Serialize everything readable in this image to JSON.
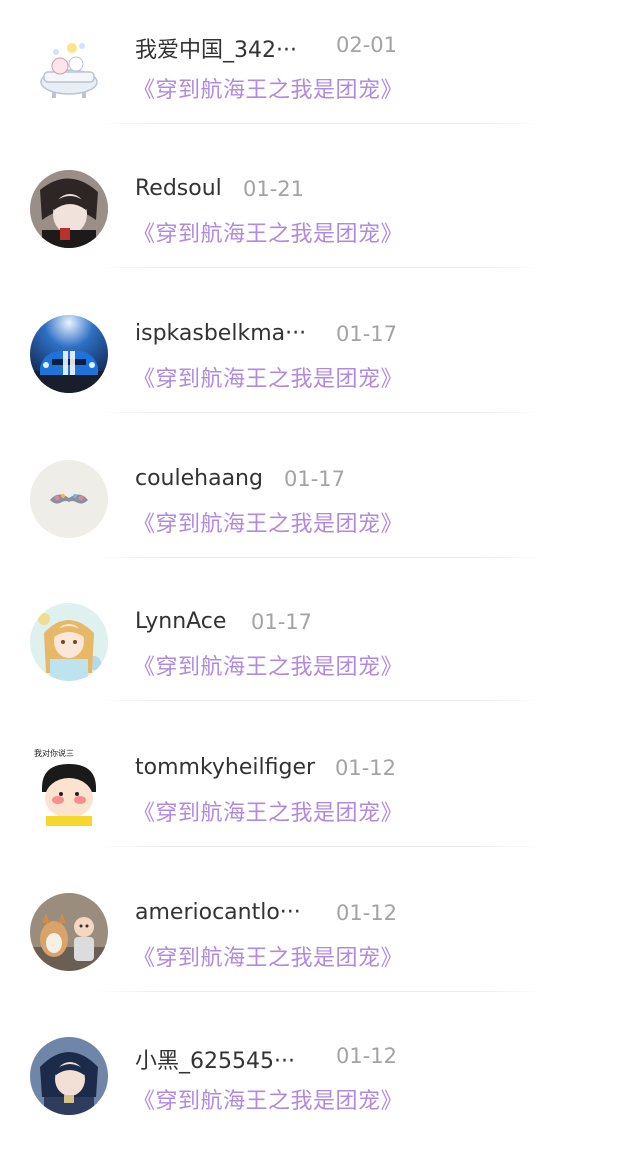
{
  "comments": [
    {
      "user": "我爱中国_342···",
      "date": "02-01",
      "book": "《穿到航海王之我是团宠》",
      "avatar_icon": "bathtub-cartoon-avatar"
    },
    {
      "user": "Redsoul",
      "date": "01-21",
      "book": "《穿到航海王之我是团宠》",
      "avatar_icon": "dark-anime-avatar"
    },
    {
      "user": "ispkasbelkma···",
      "date": "01-17",
      "book": "《穿到航海王之我是团宠》",
      "avatar_icon": "blue-car-avatar"
    },
    {
      "user": "coulehaang",
      "date": "01-17",
      "book": "《穿到航海王之我是团宠》",
      "avatar_icon": "mustache-avatar"
    },
    {
      "user": "LynnAce",
      "date": "01-17",
      "book": "《穿到航海王之我是团宠》",
      "avatar_icon": "anime-girl-avatar"
    },
    {
      "user": "tommkyheilfiger",
      "date": "01-12",
      "book": "《穿到航海王之我是团宠》",
      "avatar_icon": "blushing-cartoon-avatar",
      "avatar_caption": "我对你说三"
    },
    {
      "user": "ameriocantlo···",
      "date": "01-12",
      "book": "《穿到航海王之我是团宠》",
      "avatar_icon": "dog-and-baby-avatar"
    },
    {
      "user": "小黑_625545···",
      "date": "01-12",
      "book": "《穿到航海王之我是团宠》",
      "avatar_icon": "anime-boy-avatar"
    }
  ],
  "colors": {
    "username": "#333333",
    "date": "#a3a3a3",
    "book_link": "#b08ae0",
    "divider": "#ececec"
  }
}
